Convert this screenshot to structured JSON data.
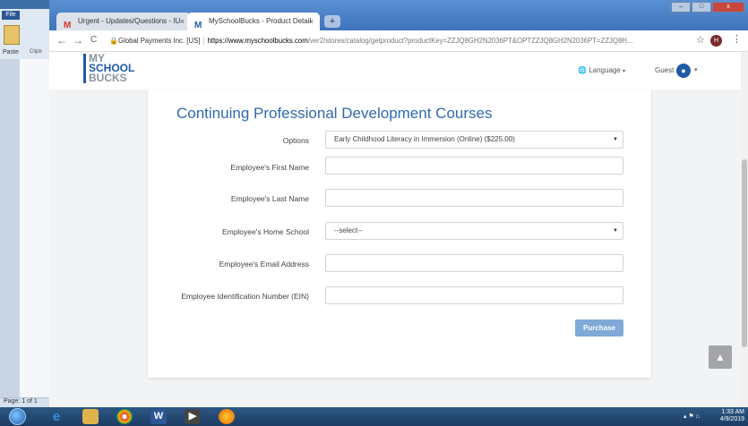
{
  "word": {
    "file_tab": "File",
    "paste_label": "Paste",
    "clip_label": "Clipb",
    "status": "Page: 1 of 1"
  },
  "browser": {
    "tabs": [
      {
        "icon": "M",
        "label": "Urgent - Updates/Questions - IU",
        "close": "×"
      },
      {
        "icon": "M",
        "label": "MySchoolBucks - Product Detail",
        "close": "×"
      }
    ],
    "new_tab": "+",
    "window_controls": {
      "minimize": "–",
      "maximize": "□",
      "close": "x"
    },
    "nav": {
      "back": "←",
      "forward": "→",
      "reload": "C"
    },
    "address": {
      "cert": "Global Payments Inc. [US]",
      "domain": "https://www.myschoolbucks.com",
      "path": "/ver2/stores/catalog/getproduct?productKey=ZZJQ8GH2N2036PT&OPTZZJQ8GH2N2036PT=ZZJQ8H..."
    },
    "profile_initial": "H"
  },
  "site": {
    "logo": {
      "line1": "MY",
      "line2": "SCHOOL",
      "line3": "BUCKS"
    },
    "language": "Language",
    "guest": "Guest"
  },
  "form": {
    "title": "Continuing Professional Development Courses",
    "fields": [
      {
        "label": "Options",
        "value": "Early Childhood Literacy in Immersion (Online) ($225.00)",
        "type": "select"
      },
      {
        "label": "Employee's First Name",
        "value": "",
        "type": "text"
      },
      {
        "label": "Employee's Last Name",
        "value": "",
        "type": "text"
      },
      {
        "label": "Employee's Home School",
        "value": "--select--",
        "type": "select"
      },
      {
        "label": "Employee's Email Address",
        "value": "",
        "type": "text"
      },
      {
        "label": "Employee Identification Number (EIN)",
        "value": "",
        "type": "text"
      }
    ],
    "purchase_label": "Purchase"
  },
  "taskbar": {
    "time": "1:33 AM",
    "date": "4/9/2019"
  },
  "colors": {
    "accent": "#2f6aad",
    "purchase_button": "#7fa9d6",
    "logo_blue": "#1f5aa6"
  }
}
